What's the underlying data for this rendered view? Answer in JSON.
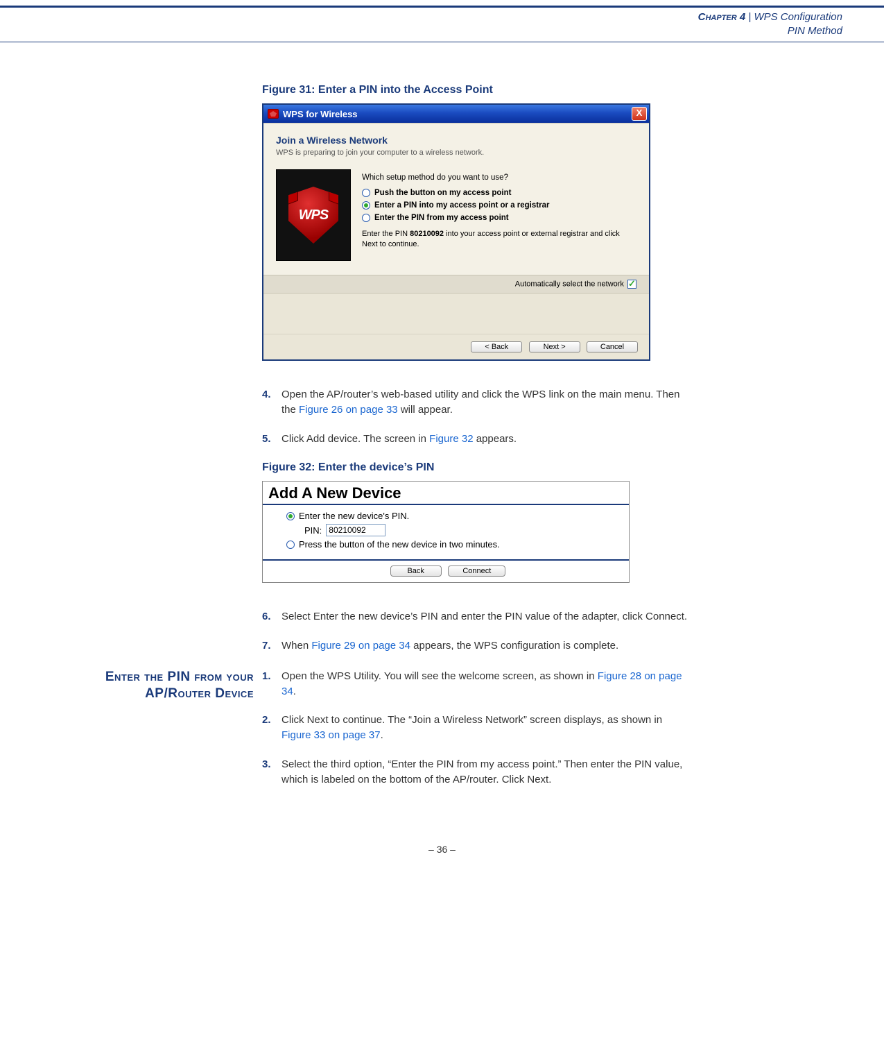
{
  "header": {
    "chapter_strong": "Chapter 4",
    "sep": "  |  ",
    "chapter_tail": "WPS Configuration",
    "subtitle": "PIN Method"
  },
  "fig31": {
    "caption": "Figure 31:  Enter a PIN into the Access Point",
    "title": "WPS for Wireless",
    "close": "X",
    "join_heading": "Join a Wireless Network",
    "join_sub": "WPS is preparing to join your computer to a wireless network.",
    "shield_text": "WPS",
    "prompt": "Which setup method do you want to use?",
    "opt1": "Push the button on my access point",
    "opt2": "Enter a PIN into my access point or a registrar",
    "opt3": "Enter the PIN from my access point",
    "hint_pre": "Enter the PIN ",
    "hint_pin": "80210092",
    "hint_post": " into your access point or external registrar and click Next to continue.",
    "auto_label": "Automatically select the network",
    "btn_back": "< Back",
    "btn_next": "Next >",
    "btn_cancel": "Cancel"
  },
  "steps_a": [
    {
      "num": "4.",
      "pre": "Open the AP/router’s web-based utility and click the WPS link on the main menu. Then the ",
      "xref": "Figure 26 on page 33",
      "post": " will appear."
    },
    {
      "num": "5.",
      "pre": "Click Add device. The screen in ",
      "xref": "Figure 32",
      "post": " appears."
    }
  ],
  "fig32": {
    "caption": "Figure 32:  Enter the device’s PIN",
    "title": "Add A New Device",
    "opt1": "Enter the new device's PIN.",
    "pin_label": "PIN:",
    "pin_value": "80210092",
    "opt2": "Press the button of the new device in two minutes.",
    "btn_back": "Back",
    "btn_connect": "Connect"
  },
  "steps_b": [
    {
      "num": "6.",
      "pre": "Select Enter the new device’s PIN and enter the PIN value of the adapter, click Connect.",
      "xref": "",
      "post": ""
    },
    {
      "num": "7.",
      "pre": "When ",
      "xref": "Figure 29 on page 34",
      "post": " appears, the WPS configuration is complete."
    }
  ],
  "section_heading": "Enter the PIN from your AP/Router Device",
  "steps_c": [
    {
      "num": "1.",
      "pre": "Open the WPS Utility. You will see the welcome screen, as shown in ",
      "xref": "Figure 28 on page 34",
      "post": "."
    },
    {
      "num": "2.",
      "pre": "Click Next to continue. The “Join a Wireless Network” screen displays, as shown in ",
      "xref": "Figure 33 on page 37",
      "post": "."
    },
    {
      "num": "3.",
      "pre": "Select the third option, “Enter the PIN from my access point.” Then enter the PIN value, which is labeled on the bottom of the AP/router. Click Next.",
      "xref": "",
      "post": ""
    }
  ],
  "page_number": "–  36  –"
}
